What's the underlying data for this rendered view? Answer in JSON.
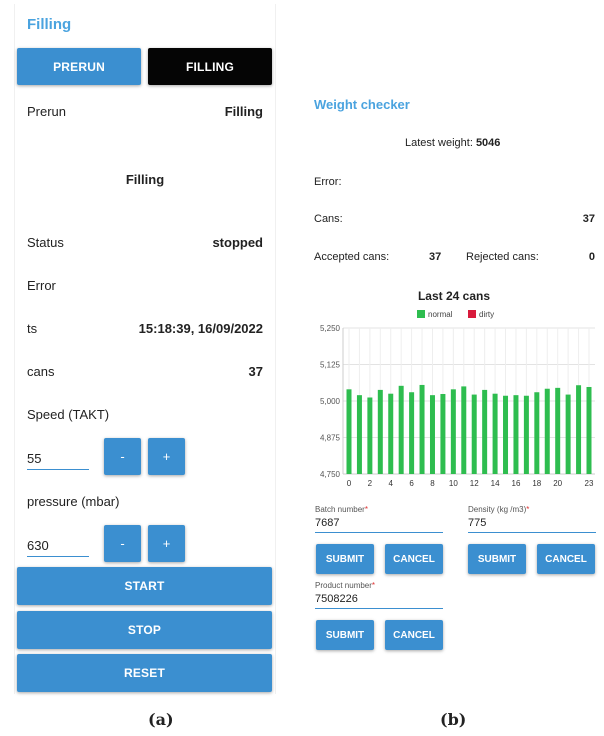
{
  "panel_a": {
    "title": "Filling",
    "mode_buttons": [
      "PRERUN",
      "FILLING"
    ],
    "prerun_label": "Prerun",
    "prerun_value": "Filling",
    "section_heading": "Filling",
    "status_label": "Status",
    "status_value": "stopped",
    "error_label": "Error",
    "ts_label": "ts",
    "ts_value": "15:18:39, 16/09/2022",
    "cans_label": "cans",
    "cans_value": "37",
    "speed_label": "Speed (TAKT)",
    "speed_value": "55",
    "pressure_label": "pressure (mbar)",
    "pressure_value": "630",
    "minus": "-",
    "plus": "+",
    "start": "START",
    "stop": "STOP",
    "reset": "RESET",
    "caption": "(a)"
  },
  "panel_b": {
    "title": "Weight checker",
    "latest_weight_label": "Latest weight:",
    "latest_weight_value": "5046",
    "error_label": "Error:",
    "cans_label": "Cans:",
    "cans_value": "37",
    "accepted_label": "Accepted cans:",
    "accepted_value": "37",
    "rejected_label": "Rejected cans:",
    "rejected_value": "0",
    "batch_label": "Batch number",
    "batch_value": "7687",
    "density_label": "Density (kg /m3)",
    "density_value": "775",
    "product_label": "Product number",
    "product_value": "7508226",
    "required_mark": "*",
    "submit": "SUBMIT",
    "cancel": "CANCEL",
    "caption": "(b)"
  },
  "colors": {
    "accent": "#3b8fd0",
    "title_blue": "#4aa3df",
    "normal": "#2ebd4f",
    "dirty": "#d81b3c"
  },
  "chart_data": {
    "type": "bar",
    "title": "Last 24 cans",
    "legend": [
      "normal",
      "dirty"
    ],
    "legend_position": "top",
    "x": [
      0,
      1,
      2,
      3,
      4,
      5,
      6,
      7,
      8,
      9,
      10,
      11,
      12,
      13,
      14,
      15,
      16,
      17,
      18,
      19,
      20,
      21,
      22,
      23
    ],
    "x_tick_labels": [
      "0",
      "2",
      "4",
      "6",
      "8",
      "10",
      "12",
      "14",
      "16",
      "18",
      "20",
      "23"
    ],
    "values": [
      5040,
      5020,
      5012,
      5038,
      5025,
      5052,
      5030,
      5055,
      5020,
      5024,
      5040,
      5050,
      5022,
      5038,
      5025,
      5018,
      5020,
      5018,
      5030,
      5042,
      5045,
      5022,
      5054,
      5048
    ],
    "ylim": [
      4750,
      5250
    ],
    "y_ticks": [
      "4,750",
      "4,875",
      "5,000",
      "5,125",
      "5,250"
    ],
    "grid": true
  }
}
